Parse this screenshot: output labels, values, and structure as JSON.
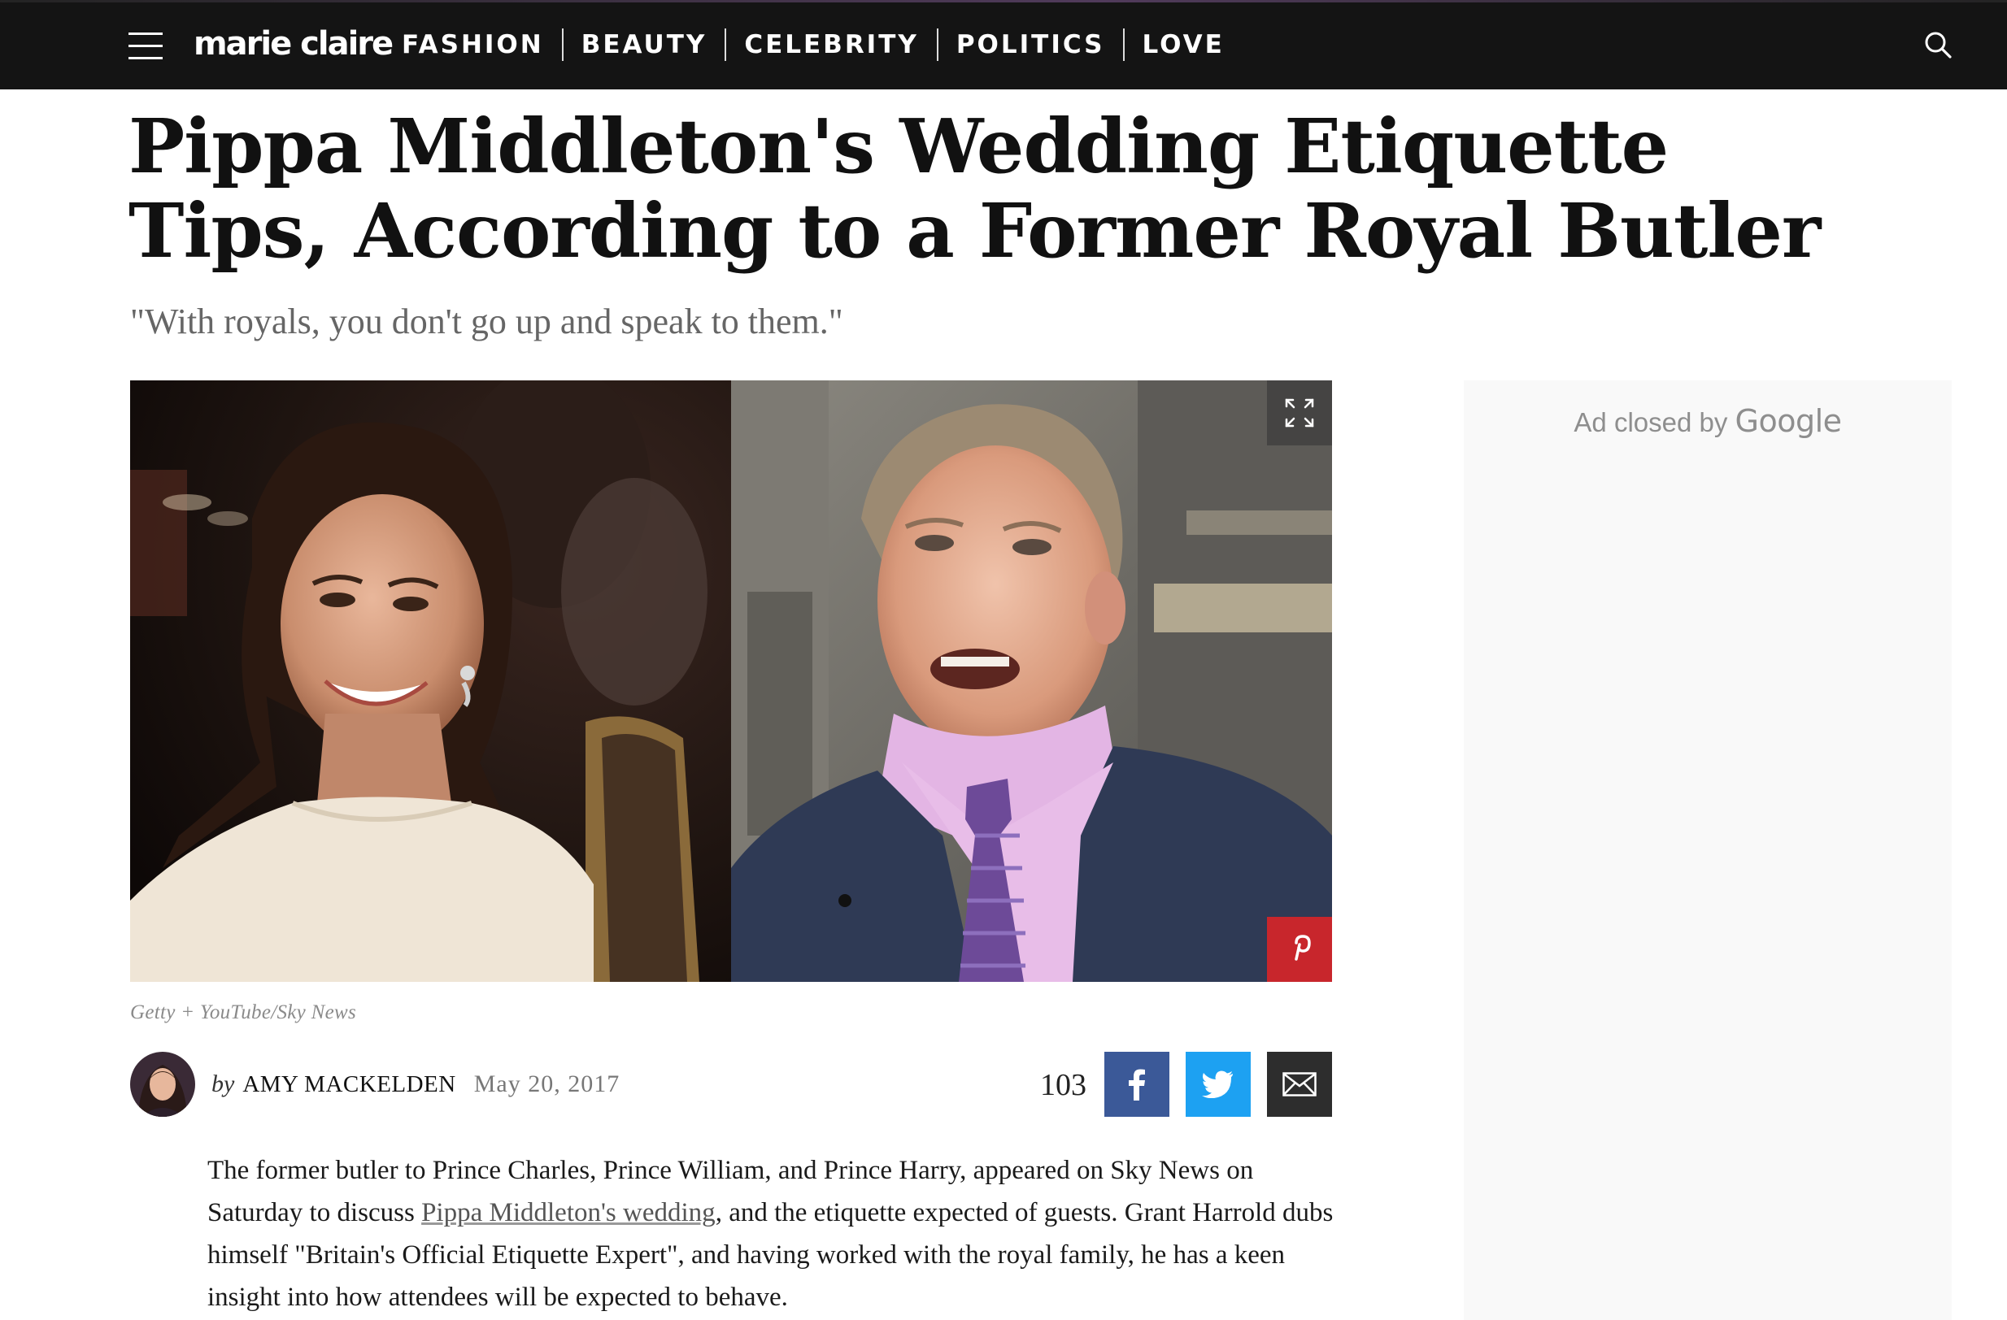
{
  "nav": {
    "logo_text": "marie claire",
    "items": [
      {
        "label": "FASHION"
      },
      {
        "label": "BEAUTY"
      },
      {
        "label": "CELEBRITY"
      },
      {
        "label": "POLITICS"
      },
      {
        "label": "LOVE"
      }
    ],
    "menu_icon": "hamburger-menu-icon",
    "search_icon": "search-icon"
  },
  "article": {
    "title": "Pippa Middleton's Wedding Etiquette Tips, According to a Former Royal Butler",
    "dek": "\"With royals, you don't go up and speak to them.\"",
    "image_credit": "Getty + YouTube/Sky News",
    "byline": {
      "by": "by",
      "author": "AMY MACKELDEN",
      "date": "May 20, 2017"
    },
    "share": {
      "count": "103",
      "facebook_icon": "facebook-icon",
      "twitter_icon": "twitter-icon",
      "email_icon": "email-icon"
    },
    "body": {
      "before_link": "The former butler to Prince Charles, Prince William, and Prince Harry, appeared on Sky News on Saturday to discuss ",
      "link_text": "Pippa Middleton's wedding",
      "after_link": ", and the etiquette expected of guests. Grant Harrold dubs himself \"Britain's Official Etiquette Expert\", and having worked with the royal family, he has a keen insight into how attendees will be expected to behave."
    }
  },
  "ad": {
    "label": "Ad closed by",
    "brand": "Google"
  },
  "colors": {
    "nav_bg": "#141414",
    "facebook": "#3b5998",
    "twitter": "#1da1f2",
    "email": "#2d2d2d",
    "pinterest": "#c8262c"
  }
}
